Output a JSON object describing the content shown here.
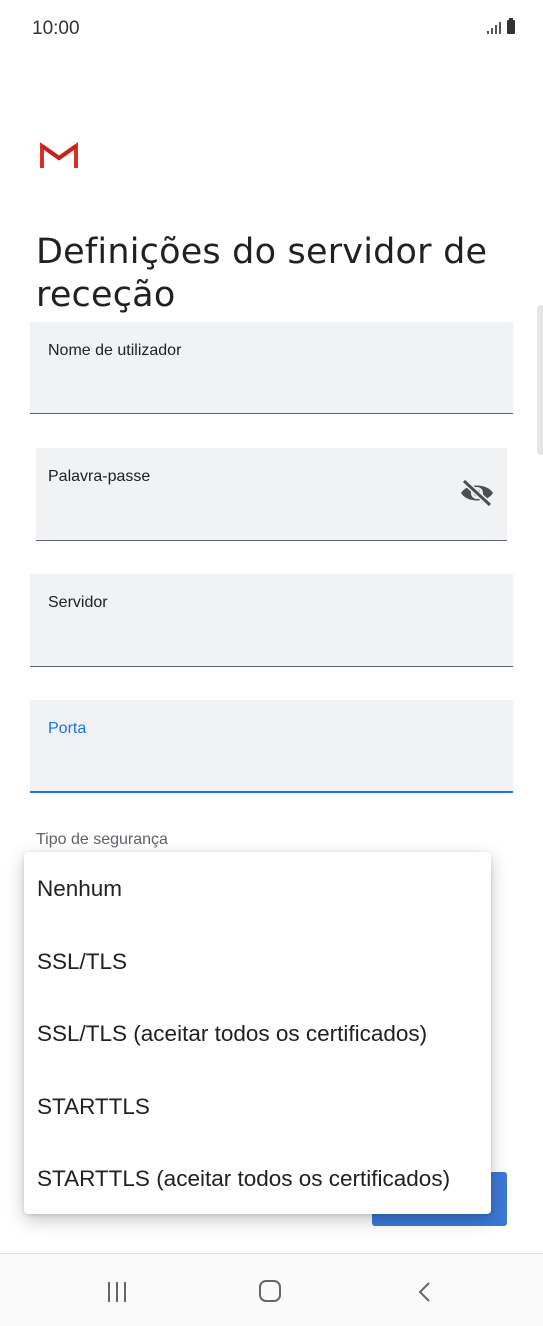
{
  "status_bar": {
    "time": "10:00"
  },
  "app": {
    "logo_icon": "gmail-logo-icon"
  },
  "page": {
    "title": "Definições do servidor de receção"
  },
  "fields": {
    "username": {
      "label": "Nome de utilizador",
      "value": ""
    },
    "password": {
      "label": "Palavra-passe",
      "value": "",
      "toggle_icon": "visibility-off-icon"
    },
    "server": {
      "label": "Servidor",
      "value": ""
    },
    "port": {
      "label": "Porta",
      "value": "",
      "focused": true
    }
  },
  "security": {
    "label": "Tipo de segurança",
    "options": [
      "Nenhum",
      "SSL/TLS",
      "SSL/TLS (aceitar todos os certificados)",
      "STARTTLS",
      "STARTTLS (aceitar todos os certificados)"
    ]
  },
  "colors": {
    "accent": "#1a73e8",
    "field_background": "#f1f2f4",
    "gmail_red": "#d93025",
    "button_blue": "#3c78d8"
  },
  "nav_bar": {
    "recent_icon": "recent-apps-icon",
    "home_icon": "home-icon",
    "back_icon": "back-icon"
  }
}
